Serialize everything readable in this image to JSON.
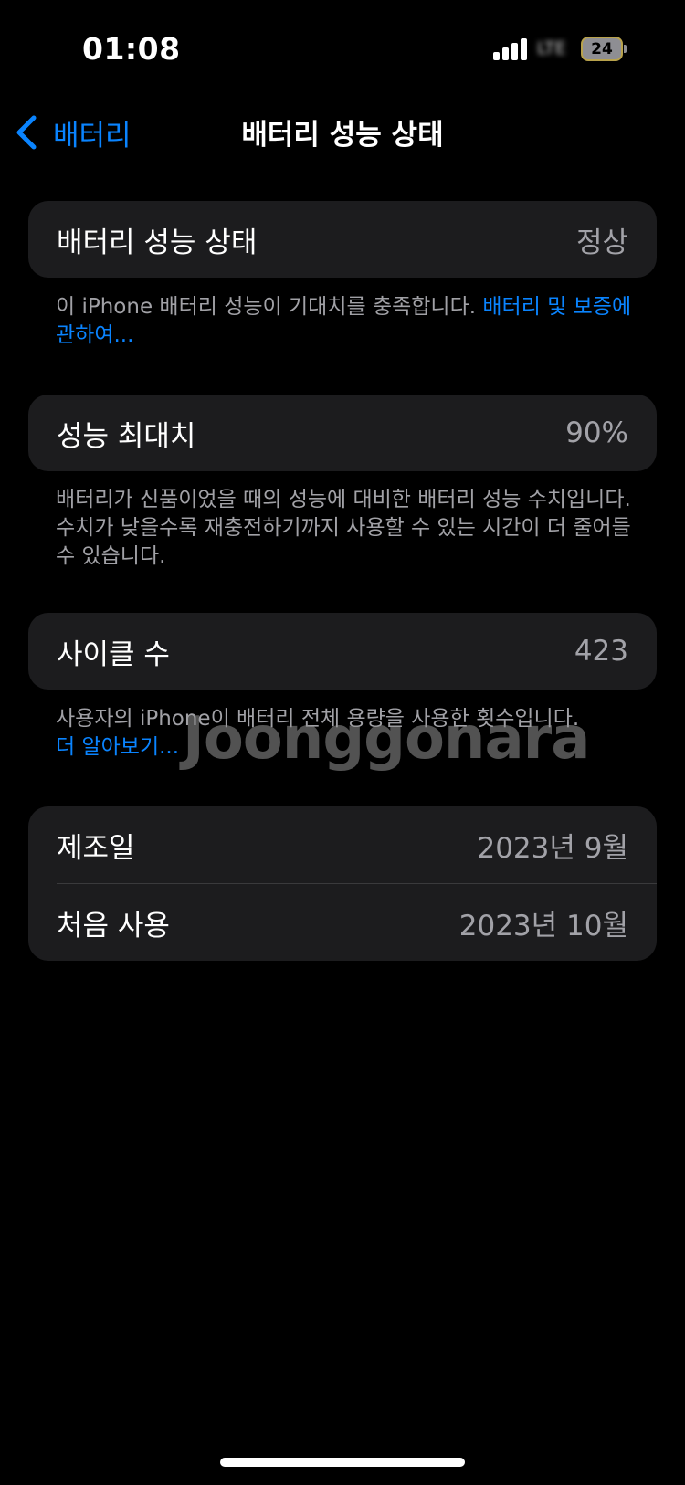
{
  "status_bar": {
    "time": "01:08",
    "carrier": "LTE",
    "battery_level": "24"
  },
  "nav": {
    "back_label": "배터리",
    "title": "배터리 성능 상태"
  },
  "health": {
    "label": "배터리 성능 상태",
    "value": "정상",
    "footnote_text": "이 iPhone 배터리 성능이 기대치를 충족합니다. ",
    "footnote_link": "배터리 및 보증에 관하여..."
  },
  "max_capacity": {
    "label": "성능 최대치",
    "value": "90%",
    "footnote_text": "배터리가 신품이었을 때의 성능에 대비한 배터리 성능 수치입니다. 수치가 낮을수록 재충전하기까지 사용할 수 있는 시간이 더 줄어들 수 있습니다."
  },
  "cycle_count": {
    "label": "사이클 수",
    "value": "423",
    "footnote_text": "사용자의 iPhone이 배터리 전체 용량을 사용한 횟수입니다.",
    "footnote_link": "더 알아보기..."
  },
  "dates": {
    "manufactured_label": "제조일",
    "manufactured_value": "2023년 9월",
    "first_use_label": "처음 사용",
    "first_use_value": "2023년 10월"
  },
  "watermark": "Joonggonara",
  "colors": {
    "background": "#000000",
    "card": "#1c1c1e",
    "accent": "#0a84ff",
    "secondary_text": "#a1a1a6"
  }
}
